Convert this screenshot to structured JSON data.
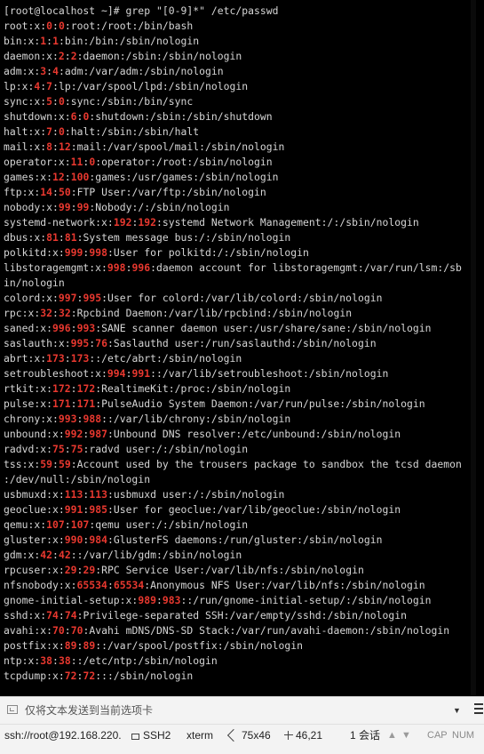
{
  "terminal": {
    "prompt": "[root@localhost ~]# grep \"[0-9]*\" /etc/passwd",
    "lines": [
      "root:x:0:0:root:/root:/bin/bash",
      "bin:x:1:1:bin:/bin:/sbin/nologin",
      "daemon:x:2:2:daemon:/sbin:/sbin/nologin",
      "adm:x:3:4:adm:/var/adm:/sbin/nologin",
      "lp:x:4:7:lp:/var/spool/lpd:/sbin/nologin",
      "sync:x:5:0:sync:/sbin:/bin/sync",
      "shutdown:x:6:0:shutdown:/sbin:/sbin/shutdown",
      "halt:x:7:0:halt:/sbin:/sbin/halt",
      "mail:x:8:12:mail:/var/spool/mail:/sbin/nologin",
      "operator:x:11:0:operator:/root:/sbin/nologin",
      "games:x:12:100:games:/usr/games:/sbin/nologin",
      "ftp:x:14:50:FTP User:/var/ftp:/sbin/nologin",
      "nobody:x:99:99:Nobody:/:/sbin/nologin",
      "systemd-network:x:192:192:systemd Network Management:/:/sbin/nologin",
      "dbus:x:81:81:System message bus:/:/sbin/nologin",
      "polkitd:x:999:998:User for polkitd:/:/sbin/nologin",
      "libstoragemgmt:x:998:996:daemon account for libstoragemgmt:/var/run/lsm:/sb",
      "in/nologin",
      "colord:x:997:995:User for colord:/var/lib/colord:/sbin/nologin",
      "rpc:x:32:32:Rpcbind Daemon:/var/lib/rpcbind:/sbin/nologin",
      "saned:x:996:993:SANE scanner daemon user:/usr/share/sane:/sbin/nologin",
      "saslauth:x:995:76:Saslauthd user:/run/saslauthd:/sbin/nologin",
      "abrt:x:173:173::/etc/abrt:/sbin/nologin",
      "setroubleshoot:x:994:991::/var/lib/setroubleshoot:/sbin/nologin",
      "rtkit:x:172:172:RealtimeKit:/proc:/sbin/nologin",
      "pulse:x:171:171:PulseAudio System Daemon:/var/run/pulse:/sbin/nologin",
      "chrony:x:993:988::/var/lib/chrony:/sbin/nologin",
      "unbound:x:992:987:Unbound DNS resolver:/etc/unbound:/sbin/nologin",
      "radvd:x:75:75:radvd user:/:/sbin/nologin",
      "tss:x:59:59:Account used by the trousers package to sandbox the tcsd daemon",
      ":/dev/null:/sbin/nologin",
      "usbmuxd:x:113:113:usbmuxd user:/:/sbin/nologin",
      "geoclue:x:991:985:User for geoclue:/var/lib/geoclue:/sbin/nologin",
      "qemu:x:107:107:qemu user:/:/sbin/nologin",
      "gluster:x:990:984:GlusterFS daemons:/run/gluster:/sbin/nologin",
      "gdm:x:42:42::/var/lib/gdm:/sbin/nologin",
      "rpcuser:x:29:29:RPC Service User:/var/lib/nfs:/sbin/nologin",
      "nfsnobody:x:65534:65534:Anonymous NFS User:/var/lib/nfs:/sbin/nologin",
      "gnome-initial-setup:x:989:983::/run/gnome-initial-setup/:/sbin/nologin",
      "sshd:x:74:74:Privilege-separated SSH:/var/empty/sshd:/sbin/nologin",
      "avahi:x:70:70:Avahi mDNS/DNS-SD Stack:/var/run/avahi-daemon:/sbin/nologin",
      "postfix:x:89:89::/var/spool/postfix:/sbin/nologin",
      "ntp:x:38:38::/etc/ntp:/sbin/nologin",
      "tcpdump:x:72:72:::/sbin/nologin"
    ],
    "text_color": "#d6d6d6",
    "match_color": "#e8382f",
    "background": "#000000"
  },
  "send_bar": {
    "placeholder": "仅将文本发送到当前选项卡",
    "icon": "send-text-icon",
    "dropdown_icon": "chevron-down-icon",
    "menu_icon": "menu-icon"
  },
  "status_bar": {
    "connection": "ssh://root@192.168.220.",
    "protocol": "SSH2",
    "terminal_type": "xterm",
    "size": "75x46",
    "cursor_pos": "46,21",
    "sessions": "1 会话",
    "up_arrow": "▲",
    "down_arrow": "▼",
    "caps": "CAP",
    "num": "NUM"
  }
}
